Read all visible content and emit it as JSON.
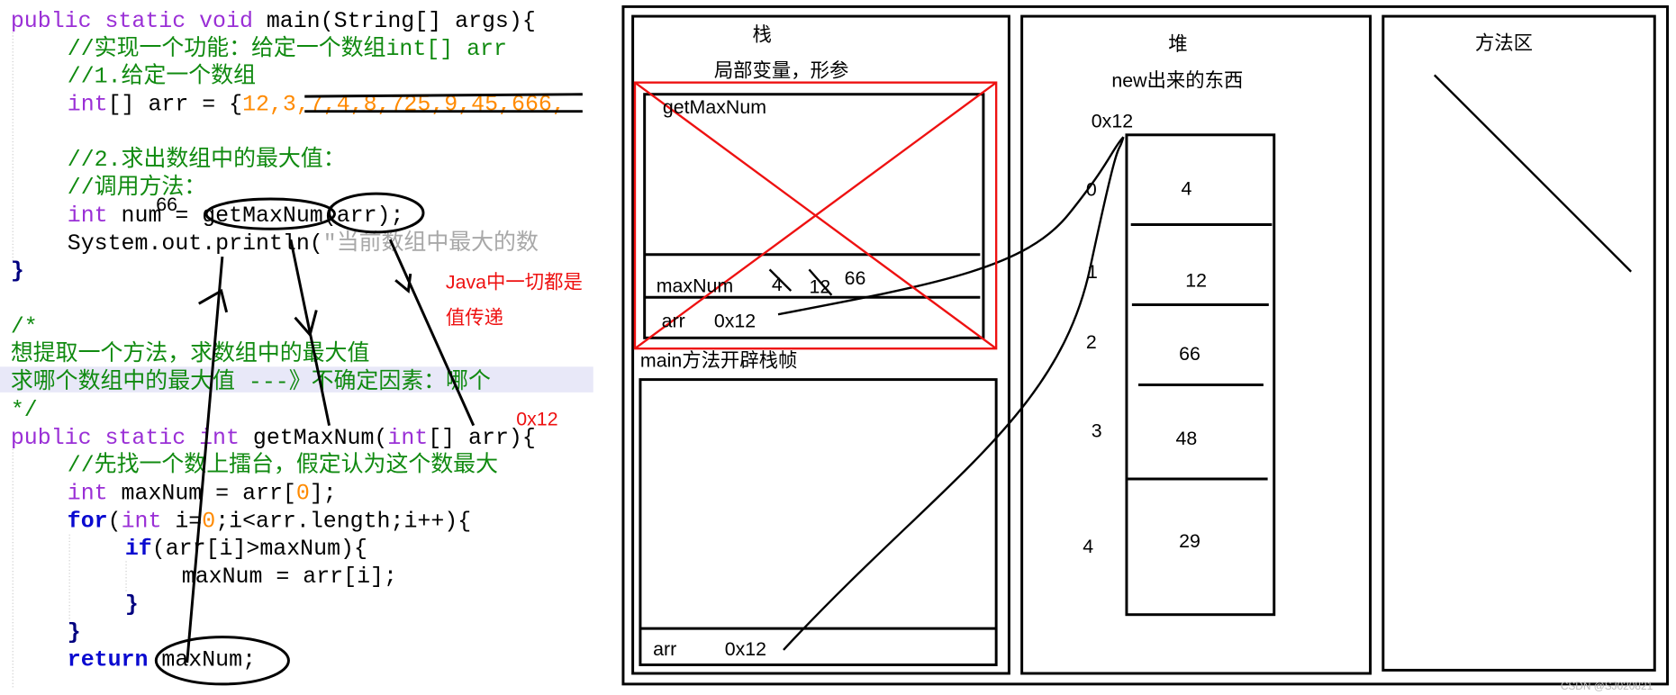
{
  "code": {
    "lines": [
      [
        [
          "public static void ",
          "kw"
        ],
        [
          "main(String[] args){",
          "default"
        ]
      ],
      [
        [
          "//实现一个功能：给定一个数组int[] arr",
          "cmt"
        ]
      ],
      [
        [
          "//1.给定一个数组",
          "cmt"
        ]
      ],
      [
        [
          "int",
          "kw"
        ],
        [
          "[] arr = {",
          "default"
        ],
        [
          "12,3,7,4,8,725,9,45,666,",
          "num"
        ]
      ],
      [],
      [
        [
          "//2.求出数组中的最大值：",
          "cmt"
        ]
      ],
      [
        [
          "//调用方法：",
          "cmt"
        ]
      ],
      [
        [
          "int",
          "kw"
        ],
        [
          " num = getMaxNum(arr);",
          "default"
        ]
      ],
      [
        [
          "System.out.println(",
          "default"
        ],
        [
          "\"当前数组中最大的数",
          "str"
        ]
      ],
      [
        [
          "}",
          "brace"
        ]
      ],
      [],
      [
        [
          "/*",
          "cmt"
        ]
      ],
      [
        [
          "想提取一个方法，求数组中的最大值",
          "cmt"
        ]
      ],
      [
        [
          "求哪个数组中的最大值 ---》不确定因素：哪个",
          "cmt"
        ]
      ],
      [
        [
          "*/",
          "cmt"
        ]
      ],
      [
        [
          "public static int ",
          "kw"
        ],
        [
          "getMaxNum(",
          "default"
        ],
        [
          "int",
          "kw"
        ],
        [
          "[] arr){",
          "default"
        ]
      ],
      [
        [
          "//先找一个数上擂台，假定认为这个数最大",
          "cmt"
        ]
      ],
      [
        [
          "int",
          "kw"
        ],
        [
          " maxNum = arr[",
          "default"
        ],
        [
          "0",
          "num"
        ],
        [
          "];",
          "default"
        ]
      ],
      [
        [
          "for",
          "ctl"
        ],
        [
          "(",
          "default"
        ],
        [
          "int",
          "kw"
        ],
        [
          " i=",
          "default"
        ],
        [
          "0",
          "num"
        ],
        [
          ";i<arr.length;i++){",
          "default"
        ]
      ],
      [
        [
          "if",
          "ctl"
        ],
        [
          "(arr[i]>maxNum){",
          "default"
        ]
      ],
      [
        [
          "maxNum = arr[i];",
          "default"
        ]
      ],
      [
        [
          "}",
          "brace"
        ]
      ],
      [
        [
          "}",
          "brace"
        ]
      ],
      [
        [
          "return",
          "ctl"
        ],
        [
          " maxNum;",
          "default"
        ]
      ]
    ],
    "indent": [
      0,
      1,
      1,
      1,
      0,
      1,
      1,
      1,
      1,
      0,
      0,
      0,
      0,
      0,
      0,
      0,
      1,
      1,
      1,
      2,
      3,
      2,
      1,
      1
    ],
    "highlighted_line": 13
  },
  "annotations": {
    "return_value": "66",
    "value_passing_1": "Java中一切都是",
    "value_passing_2": "值传递",
    "param_address": "0x12"
  },
  "stack": {
    "title": "栈",
    "subtitle": "局部变量，形参",
    "frame_getmaxnum": {
      "name": "getMaxNum",
      "maxnum_label": "maxNum",
      "maxnum_values_struck": [
        "4",
        "12"
      ],
      "maxnum_value": "66",
      "arr_label": "arr",
      "arr_value": "0x12"
    },
    "main_frame_label": "main方法开辟栈帧",
    "frame_main": {
      "arr_label": "arr",
      "arr_value": "0x12"
    }
  },
  "heap": {
    "title": "堆",
    "subtitle": "new出来的东西",
    "address": "0x12",
    "indices": [
      "0",
      "1",
      "2",
      "3",
      "4"
    ],
    "values": [
      "4",
      "12",
      "66",
      "48",
      "29"
    ]
  },
  "method_area": {
    "title": "方法区"
  },
  "watermark": "CSDN @SJ020821",
  "colors": {
    "annotation_red": "#ee1111",
    "ink": "#000000",
    "highlight": "#e8e8f8"
  }
}
